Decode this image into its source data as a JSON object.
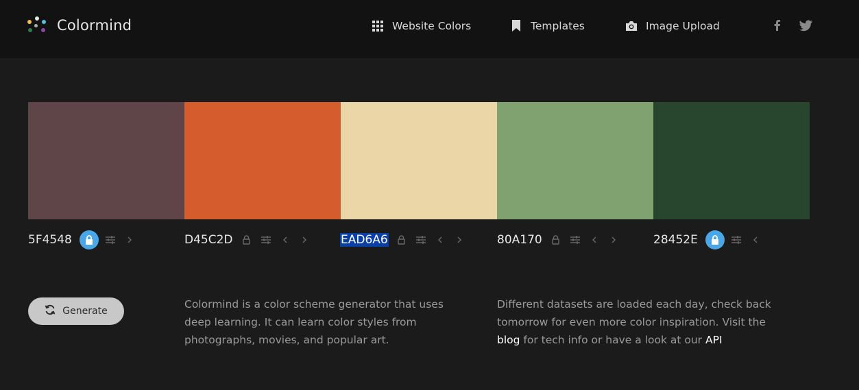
{
  "header": {
    "brand": "Colormind",
    "nav": [
      {
        "label": "Website Colors",
        "icon": "grid-icon"
      },
      {
        "label": "Templates",
        "icon": "bookmark-icon"
      },
      {
        "label": "Image Upload",
        "icon": "camera-icon"
      }
    ],
    "social": [
      "facebook-icon",
      "twitter-icon"
    ]
  },
  "palette": [
    {
      "hex": "5F4548",
      "color": "#5F4548",
      "locked": true
    },
    {
      "hex": "D45C2D",
      "color": "#D45C2D",
      "locked": false
    },
    {
      "hex": "EAD6A6",
      "color": "#EAD6A6",
      "locked": false,
      "selected": true
    },
    {
      "hex": "80A170",
      "color": "#80A170",
      "locked": false
    },
    {
      "hex": "28452E",
      "color": "#28452E",
      "locked": true
    }
  ],
  "colors": {
    "accent": "#4AA6E6",
    "selection": "#0A3FA8"
  },
  "generate": {
    "label": "Generate"
  },
  "about": {
    "text": "Colormind is a color scheme generator that uses deep learning. It can learn color styles from photographs, movies, and popular art."
  },
  "info": {
    "text_before": "Different datasets are loaded each day, check back tomorrow for even more color inspiration. Visit the",
    "blog_link": "blog",
    "text_middle": "for tech info or have a look at our",
    "api_link": "API"
  }
}
